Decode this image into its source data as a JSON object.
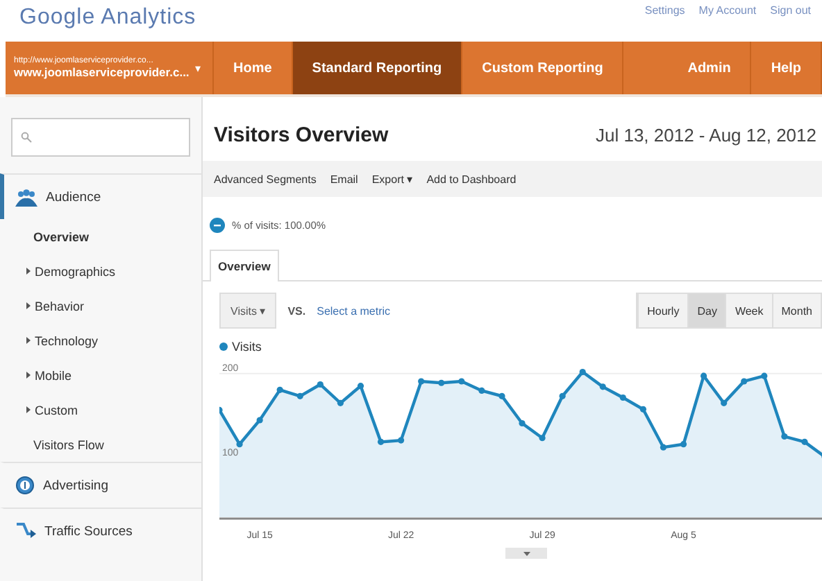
{
  "header": {
    "logo": "Google Analytics",
    "links": [
      "Settings",
      "My Account",
      "Sign out"
    ]
  },
  "account": {
    "url": "http://www.joomlaserviceprovider.co...",
    "name": "www.joomlaserviceprovider.c...",
    "caret": "▾"
  },
  "nav": [
    {
      "label": "Home",
      "selected": false
    },
    {
      "label": "Standard Reporting",
      "selected": true
    },
    {
      "label": "Custom Reporting",
      "selected": false
    }
  ],
  "nav_right": [
    "Admin",
    "Help"
  ],
  "sidebar": {
    "sections": [
      {
        "kind": "audience",
        "label": "Audience",
        "selected": true,
        "children": [
          {
            "label": "Overview",
            "selected": true,
            "arrow": false
          },
          {
            "label": "Demographics",
            "selected": false,
            "arrow": true
          },
          {
            "label": "Behavior",
            "selected": false,
            "arrow": true
          },
          {
            "label": "Technology",
            "selected": false,
            "arrow": true
          },
          {
            "label": "Mobile",
            "selected": false,
            "arrow": true
          },
          {
            "label": "Custom",
            "selected": false,
            "arrow": true
          },
          {
            "label": "Visitors Flow",
            "selected": false,
            "arrow": false
          }
        ]
      },
      {
        "kind": "advertising",
        "label": "Advertising",
        "selected": false
      },
      {
        "kind": "traffic",
        "label": "Traffic Sources",
        "selected": false
      }
    ]
  },
  "report": {
    "title": "Visitors Overview",
    "date_range": "Jul 13, 2012 - Aug 12, 2012",
    "toolbar": [
      "Advanced Segments",
      "Email",
      "Export ▾",
      "Add to Dashboard"
    ],
    "segment": "% of visits: 100.00%",
    "tabs": [
      {
        "label": "Overview",
        "selected": true
      }
    ],
    "metric": "Visits ▾",
    "vs": "VS.",
    "select_metric": "Select a metric",
    "granularity": [
      {
        "label": "Hourly",
        "selected": false
      },
      {
        "label": "Day",
        "selected": true
      },
      {
        "label": "Week",
        "selected": false
      },
      {
        "label": "Month",
        "selected": false
      }
    ],
    "chart": {
      "legend": "Visits",
      "y_labels": [
        "200",
        "100"
      ],
      "x_labels": [
        "Jul 15",
        "Jul 22",
        "Jul 29",
        "Aug 5"
      ]
    }
  }
}
